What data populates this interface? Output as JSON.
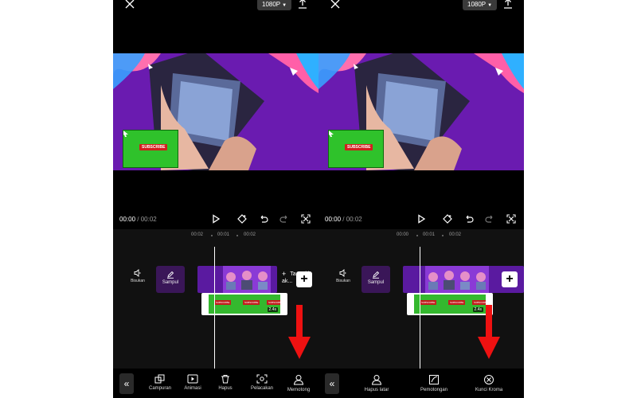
{
  "screens": [
    {
      "resolution": "1080P",
      "time_current": "00:00",
      "time_total": "/ 00:02",
      "ruler": [
        "00:02",
        "00:01",
        "00:02"
      ],
      "mute_label": "Bisukan",
      "cover_label": "Sampul",
      "add_audio_label": "Ta... aki\nak...",
      "clip_duration": "2.4s",
      "subscribe_text": "SUBSCRIBE",
      "tools": [
        "Campuran",
        "Animasi",
        "Hapus",
        "Pelacakan",
        "Memotong"
      ]
    },
    {
      "resolution": "1080P",
      "time_current": "00:00",
      "time_total": "/ 00:02",
      "ruler": [
        "00:00",
        "00:01",
        "00:02"
      ],
      "mute_label": "Bisukan",
      "cover_label": "Sampul",
      "clip_duration": "2.4s",
      "subscribe_text": "SUBSCRIBE",
      "tools": [
        "Hapus latar",
        "Pemotongan",
        "Kunci Kroma"
      ]
    }
  ],
  "colors": {
    "panel_bg": "#000000",
    "preview_bg": "#6a1bb0",
    "clip_green": "#34b82e",
    "arrow_red": "#ee1111"
  },
  "icons": [
    "close-icon",
    "export-icon",
    "play-icon",
    "keyframe-icon",
    "undo-icon",
    "redo-icon",
    "fullscreen-icon",
    "speaker-icon",
    "pencil-icon",
    "double-chevron-left-icon"
  ]
}
